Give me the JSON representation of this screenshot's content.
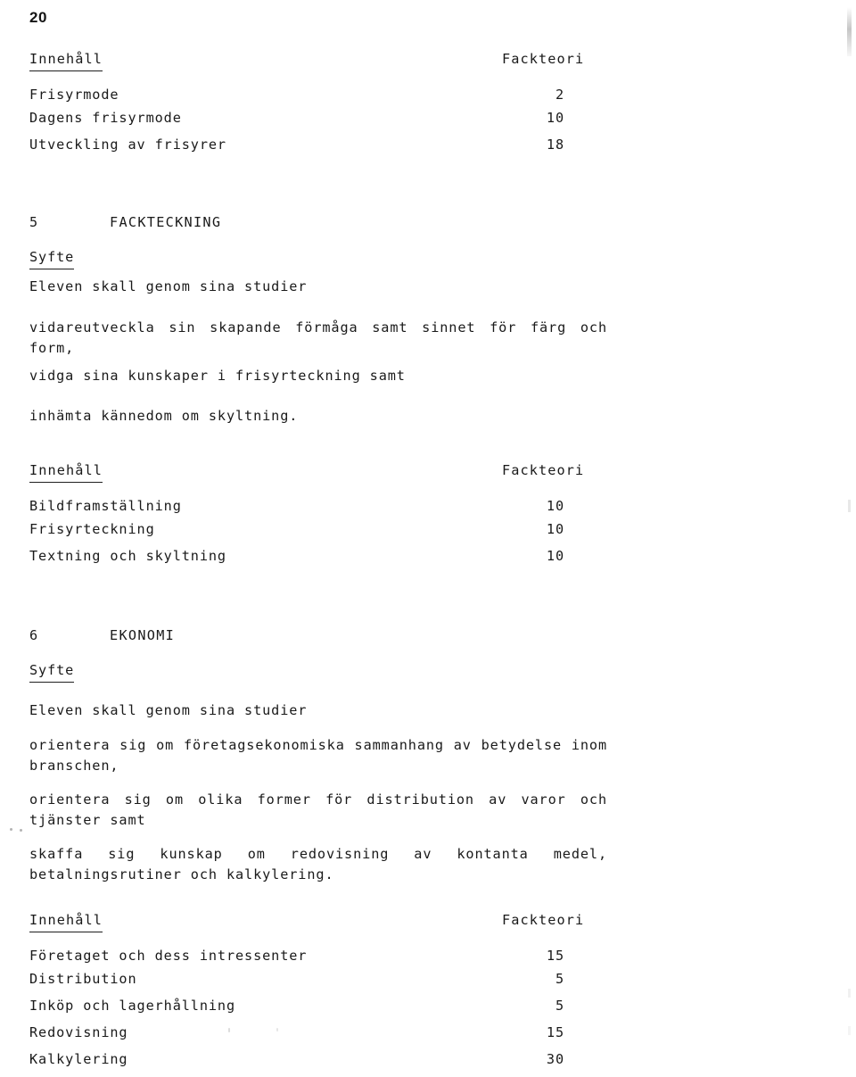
{
  "page": {
    "number": "20"
  },
  "table_headers": {
    "content": "Innehåll",
    "hours": "Fackteori"
  },
  "top_table": {
    "rows": [
      {
        "label": "Frisyrmode",
        "value": "2"
      },
      {
        "label": "Dagens frisyrmode",
        "value": "10"
      },
      {
        "label": "Utveckling av frisyrer",
        "value": "18"
      }
    ]
  },
  "section_5": {
    "number": "5",
    "title": "FACKTECKNING",
    "purpose_heading": "Syfte",
    "intro": "Eleven skall genom sina studier",
    "goals": [
      "vidareutveckla sin skapande förmåga samt sinnet för färg och form,",
      "vidga sina kunskaper i frisyrteckning samt",
      "inhämta kännedom om skyltning."
    ],
    "table": {
      "rows": [
        {
          "label": "Bildframställning",
          "value": "10"
        },
        {
          "label": "Frisyrteckning",
          "value": "10"
        },
        {
          "label": "Textning och skyltning",
          "value": "10"
        }
      ]
    }
  },
  "section_6": {
    "number": "6",
    "title": "EKONOMI",
    "purpose_heading": "Syfte",
    "intro": "Eleven skall genom sina studier",
    "goals": [
      "orientera sig om företagsekonomiska sammanhang av betydelse inom branschen,",
      "orientera sig om olika former för distribution av varor och tjänster samt",
      "skaffa sig kunskap om redovisning av kontanta medel, betalningsrutiner och kalkylering."
    ],
    "table": {
      "rows": [
        {
          "label": "Företaget och dess intressenter",
          "value": "15"
        },
        {
          "label": "Distribution",
          "value": "5"
        },
        {
          "label": "Inköp och lagerhållning",
          "value": "5"
        },
        {
          "label": "Redovisning",
          "value": "15"
        },
        {
          "label": "Kalkylering",
          "value": "30"
        }
      ]
    }
  }
}
